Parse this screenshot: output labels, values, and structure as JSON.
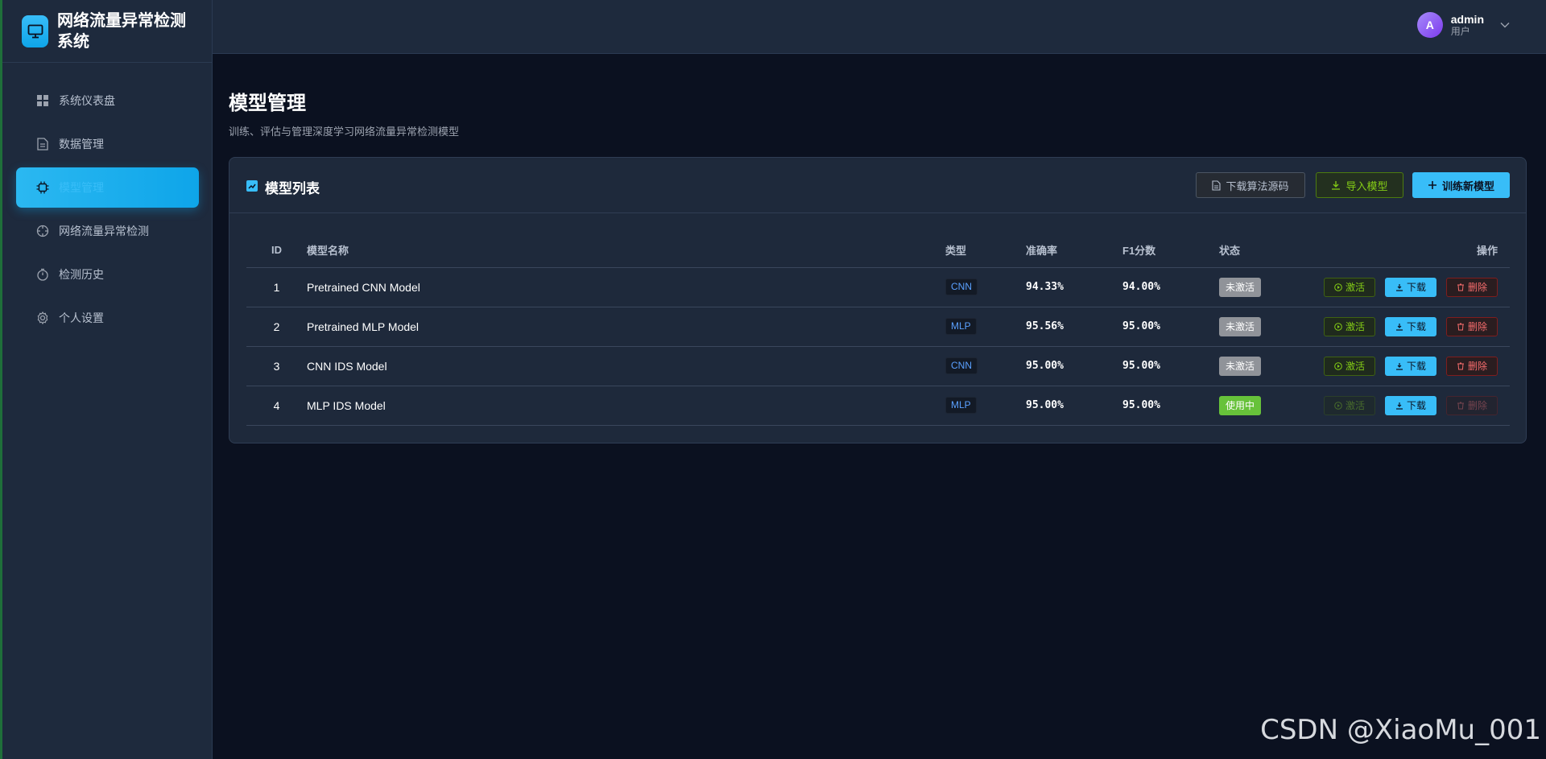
{
  "app": {
    "title": "网络流量异常检测系统"
  },
  "sidebar": {
    "items": [
      {
        "label": "系统仪表盘",
        "icon": "dashboard-icon"
      },
      {
        "label": "数据管理",
        "icon": "document-icon"
      },
      {
        "label": "模型管理",
        "icon": "chip-icon",
        "active": true
      },
      {
        "label": "网络流量异常检测",
        "icon": "crosshair-icon"
      },
      {
        "label": "检测历史",
        "icon": "stopwatch-icon"
      },
      {
        "label": "个人设置",
        "icon": "gear-icon"
      }
    ]
  },
  "header": {
    "user": {
      "initial": "A",
      "name": "admin",
      "role": "用户"
    }
  },
  "page": {
    "title": "模型管理",
    "subtitle": "训练、评估与管理深度学习网络流量异常检测模型"
  },
  "card": {
    "title": "模型列表",
    "buttons": {
      "download_source": "下载算法源码",
      "import": "导入模型",
      "train": "训练新模型"
    }
  },
  "table": {
    "headers": {
      "id": "ID",
      "name": "模型名称",
      "type": "类型",
      "accuracy": "准确率",
      "f1": "F1分数",
      "status": "状态",
      "ops": "操作"
    },
    "rows": [
      {
        "id": "1",
        "name": "Pretrained CNN Model",
        "type": "CNN",
        "accuracy": "94.33%",
        "f1": "94.00%",
        "status": "未激活"
      },
      {
        "id": "2",
        "name": "Pretrained MLP Model",
        "type": "MLP",
        "accuracy": "95.56%",
        "f1": "95.00%",
        "status": "未激活"
      },
      {
        "id": "3",
        "name": "CNN IDS Model",
        "type": "CNN",
        "accuracy": "95.00%",
        "f1": "95.00%",
        "status": "未激活"
      },
      {
        "id": "4",
        "name": "MLP IDS Model",
        "type": "MLP",
        "accuracy": "95.00%",
        "f1": "95.00%",
        "status": "使用中"
      }
    ],
    "row_actions": {
      "activate": "激活",
      "download": "下载",
      "delete": "删除"
    }
  },
  "watermark": "CSDN @XiaoMu_001",
  "colors": {
    "accent": "#38bdf8",
    "success": "#67c23a",
    "inactive": "#909399",
    "danger": "#f56c6c",
    "background": "#0b1120",
    "panel": "#1e293b"
  }
}
